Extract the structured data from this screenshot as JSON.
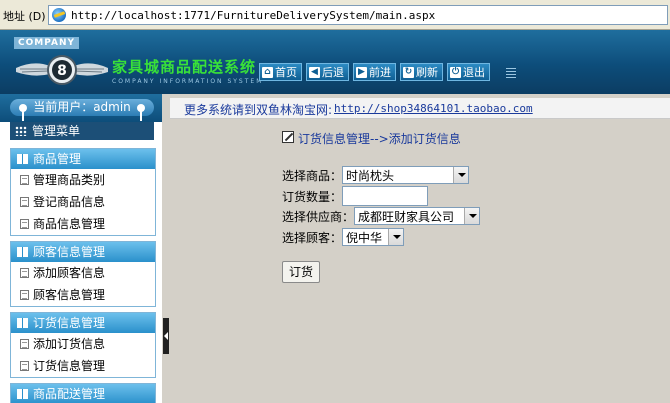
{
  "browser": {
    "address_label": "地址 (D)",
    "url": "http://localhost:1771/FurnitureDeliverySystem/main.aspx"
  },
  "header": {
    "company_tag": "COMPANY",
    "title": "家具城商品配送系统",
    "subtitle": "COMPANY INFORMATION SYSTEM",
    "nav": [
      {
        "label": "首页",
        "icon": "home-icon",
        "glyph": "⌂"
      },
      {
        "label": "后退",
        "icon": "back-arrow-icon",
        "glyph": "◀"
      },
      {
        "label": "前进",
        "icon": "forward-arrow-icon",
        "glyph": "▶"
      },
      {
        "label": "刷新",
        "icon": "refresh-icon",
        "glyph": "↻"
      },
      {
        "label": "退出",
        "icon": "power-icon",
        "glyph": "⏻"
      }
    ]
  },
  "sidebar": {
    "current_user": "当前用户：admin",
    "menu_title": "管理菜单",
    "groups": [
      {
        "title": "商品管理",
        "items": [
          "管理商品类别",
          "登记商品信息",
          "商品信息管理"
        ]
      },
      {
        "title": "顾客信息管理",
        "items": [
          "添加顾客信息",
          "顾客信息管理"
        ]
      },
      {
        "title": "订货信息管理",
        "items": [
          "添加订货信息",
          "订货信息管理"
        ]
      },
      {
        "title": "商品配送管理",
        "items": []
      }
    ]
  },
  "main": {
    "notice_text": "更多系统请到双鱼林淘宝网:",
    "notice_link": "http://shop34864101.taobao.com",
    "breadcrumb": "订货信息管理-->添加订货信息",
    "form": {
      "product_label": "选择商品：",
      "product_value": "时尚枕头",
      "quantity_label": "订货数量：",
      "quantity_value": "",
      "supplier_label": "选择供应商：",
      "supplier_value": "成都旺财家具公司",
      "customer_label": "选择顾客：",
      "customer_value": "倪中华",
      "submit_label": "订货"
    }
  },
  "colors": {
    "header_blue": "#0d4d7a",
    "title_green": "#39e139",
    "group_head_blue": "#2a90cb",
    "link_blue": "#1a3a9c"
  }
}
